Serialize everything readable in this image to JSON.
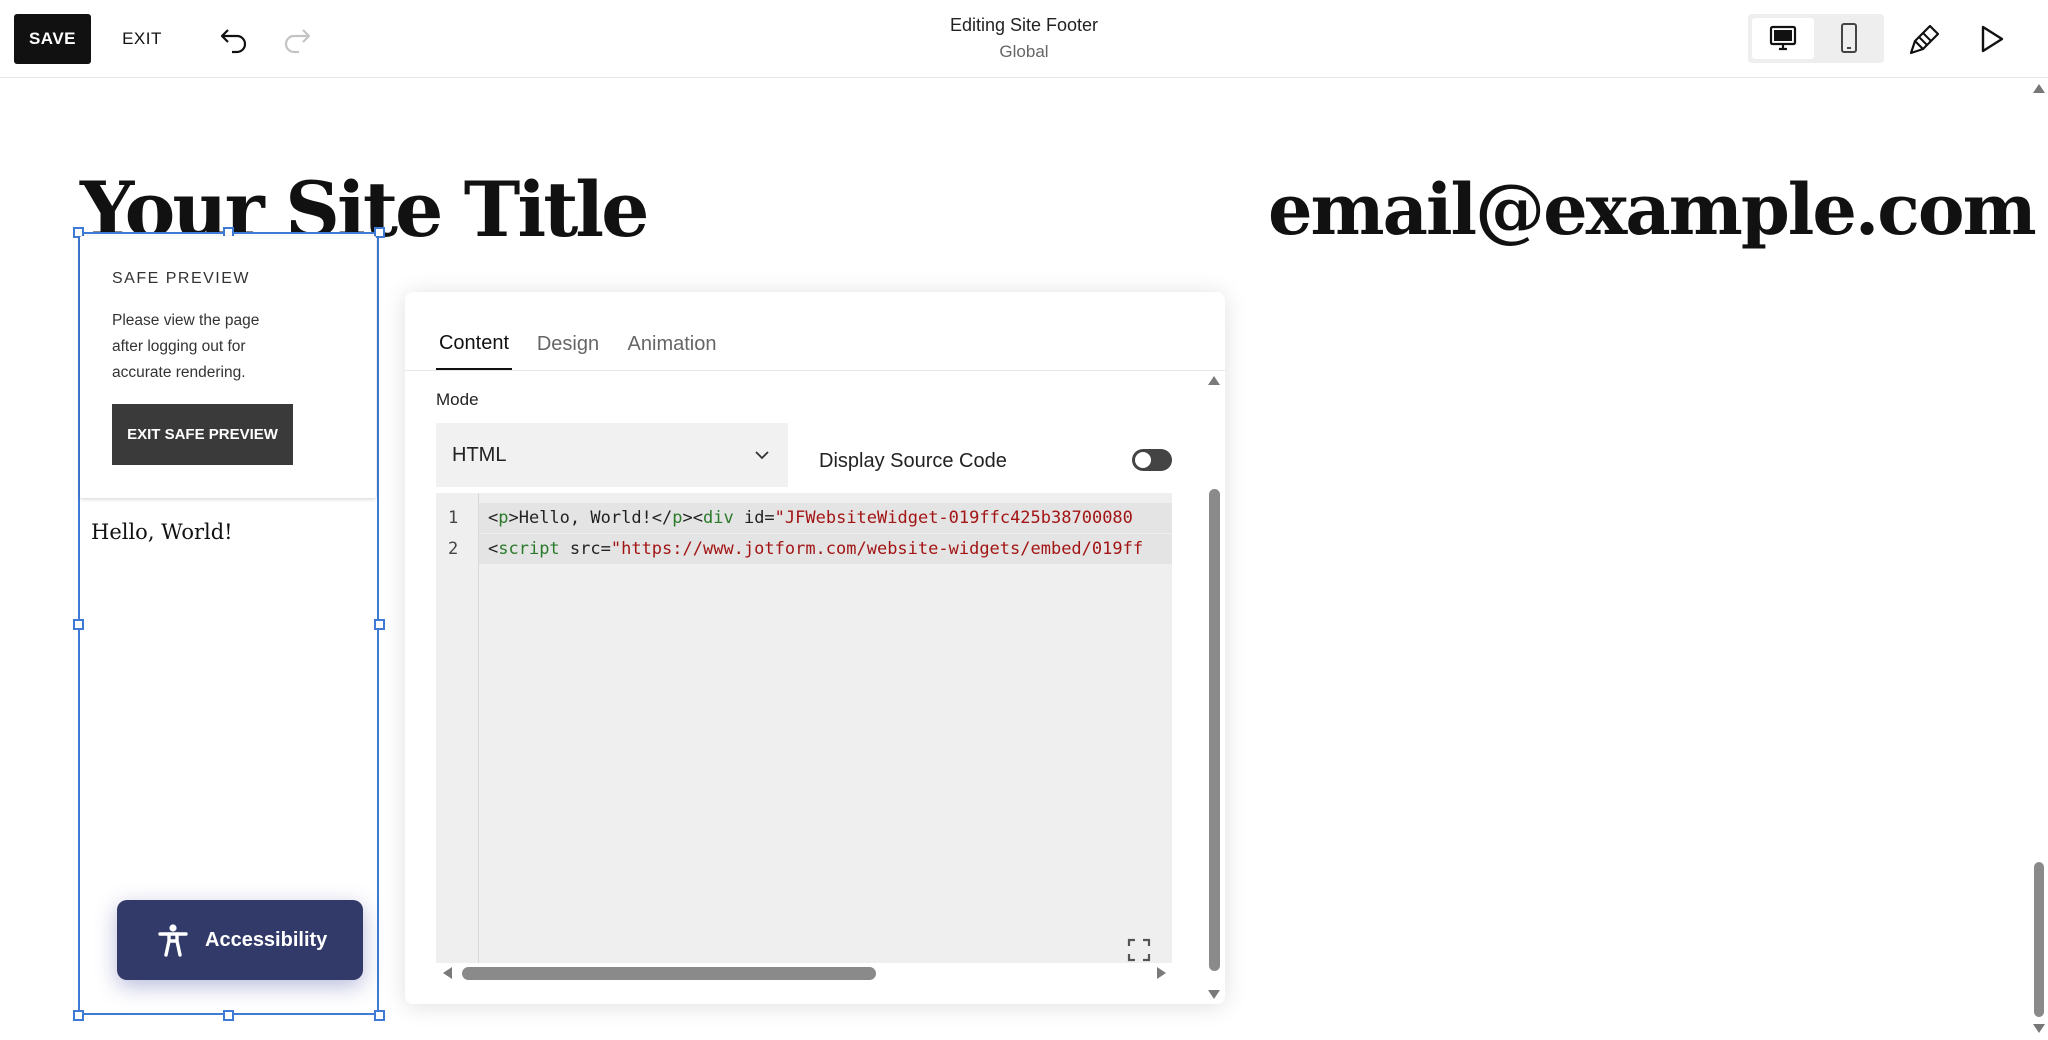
{
  "toolbar": {
    "save_label": "SAVE",
    "exit_label": "EXIT",
    "editing_title": "Editing Site Footer",
    "editing_subtitle": "Global",
    "icons": [
      "undo-icon",
      "redo-icon",
      "desktop-icon",
      "mobile-icon",
      "brush-icon",
      "play-icon"
    ]
  },
  "site": {
    "title": "Your Site Title",
    "email": "email@example.com"
  },
  "safe_preview": {
    "heading": "SAFE PREVIEW",
    "message": "Please view the page after logging out for accurate rendering.",
    "button_label": "EXIT SAFE PREVIEW"
  },
  "block": {
    "hello_text": "Hello, World!"
  },
  "accessibility": {
    "label": "Accessibility",
    "colors": {
      "background": "#323a6a"
    }
  },
  "editor": {
    "tabs": [
      {
        "label": "Content",
        "active": true
      },
      {
        "label": "Design",
        "active": false
      },
      {
        "label": "Animation",
        "active": false
      }
    ],
    "mode_label": "Mode",
    "mode_value": "HTML",
    "display_source_label": "Display Source Code",
    "display_source_on": false,
    "code_lines": [
      {
        "number": "1",
        "parts": [
          {
            "t": "<",
            "c": "tk-attr"
          },
          {
            "t": "p",
            "c": "tk-tag"
          },
          {
            "t": ">Hello, World!</",
            "c": "tk-attr"
          },
          {
            "t": "p",
            "c": "tk-tag"
          },
          {
            "t": "><",
            "c": "tk-attr"
          },
          {
            "t": "div",
            "c": "tk-tag"
          },
          {
            "t": " id=",
            "c": "tk-attr"
          },
          {
            "t": "\"JFWebsiteWidget-019ffc425b38700080",
            "c": "tk-str"
          }
        ]
      },
      {
        "number": "2",
        "parts": [
          {
            "t": "<",
            "c": "tk-attr"
          },
          {
            "t": "script",
            "c": "tk-tag"
          },
          {
            "t": " src=",
            "c": "tk-attr"
          },
          {
            "t": "\"https://www.jotform.com/website-widgets/embed/019ff",
            "c": "tk-str"
          }
        ]
      }
    ]
  }
}
